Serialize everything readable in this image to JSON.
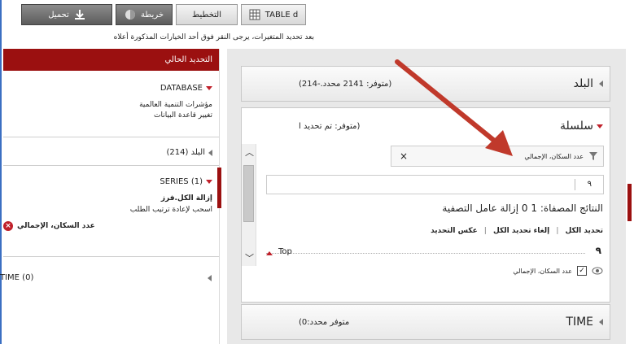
{
  "toolbar": {
    "table_label": "TABLE d",
    "layout_label": "التخطيط",
    "map_label": "خريطة",
    "download_label": "تحميل"
  },
  "hint_text": "بعد تحديد المتغيرات، يرجى النقر فوق أحد الخيارات المذكورة أعلاه",
  "sidebar": {
    "header": "التحديد الحالي",
    "database": {
      "title": "DATABASE",
      "links": [
        "مؤشرات التنمية العالمية",
        "تغيير قاعدة البيانات"
      ]
    },
    "country": {
      "title": "البلد (214)"
    },
    "series": {
      "title": "SERIES (1)",
      "clear_all": "إزالة الكل.فرز",
      "drag_hint": "اسحب لإعادة ترتيب الطلب",
      "item": "عدد السكان، الإجمالي"
    },
    "time": {
      "title": "TIME (0)"
    }
  },
  "main": {
    "country_panel": {
      "title": "البلد",
      "sub": "(متوفر: 2141 محدد.-214)"
    },
    "series_panel": {
      "title": "سلسلة",
      "sub": "(متوفر: تم تحديد ا",
      "filter_value": "عدد السكان، الإجمالي",
      "filter_clear": "×",
      "search_placeholder": "٩",
      "results_text": "النتائج المصفاة: 1 0 إزالة عامل التصفية",
      "actions": [
        "تحديد الكل",
        "إلغاء تحديد الكل",
        "عكس التحديد"
      ],
      "sort_icon_text": "٩",
      "top_label": "Top",
      "item_label": "عدد السكان، الإجمالي"
    },
    "time_panel": {
      "title": "TIME",
      "sub": "متوفر محدد:0)"
    }
  },
  "colors": {
    "accent_red": "#9b1010",
    "arrow_red": "#c0392b"
  }
}
